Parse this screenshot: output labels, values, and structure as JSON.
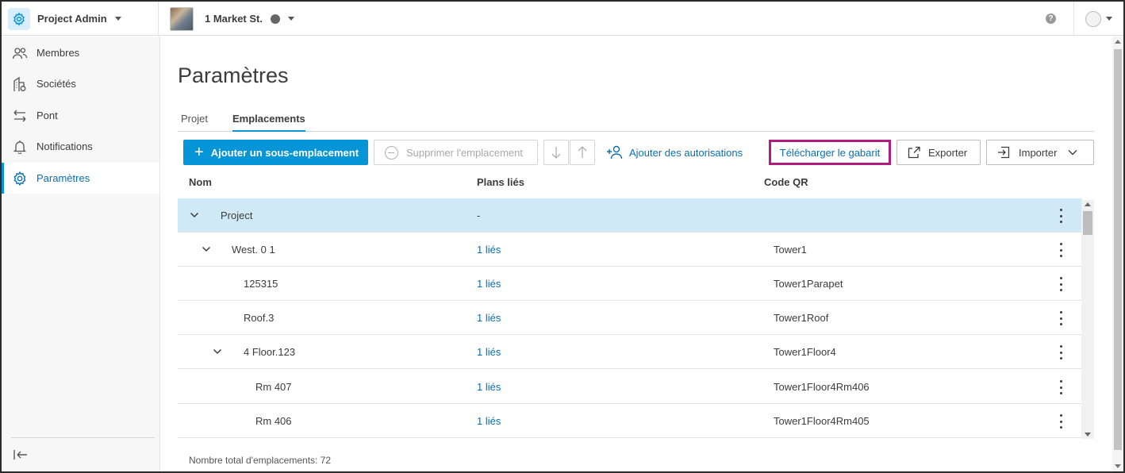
{
  "topbar": {
    "app_title": "Project Admin",
    "project_name": "1 Market St.",
    "help_glyph": "?"
  },
  "sidebar": {
    "items": [
      {
        "label": "Membres",
        "icon": "members-icon"
      },
      {
        "label": "Sociétés",
        "icon": "companies-icon"
      },
      {
        "label": "Pont",
        "icon": "bridge-icon"
      },
      {
        "label": "Notifications",
        "icon": "bell-icon"
      },
      {
        "label": "Paramètres",
        "icon": "gear-icon",
        "active": true
      }
    ]
  },
  "main": {
    "title": "Paramètres",
    "tabs": [
      {
        "label": "Projet"
      },
      {
        "label": "Emplacements",
        "active": true
      }
    ],
    "toolbar": {
      "add_sublocation": "Ajouter un sous-emplacement",
      "delete_location": "Supprimer l'emplacement",
      "add_permissions": "Ajouter des autorisations",
      "download_template": "Télécharger le gabarit",
      "export": "Exporter",
      "import": "Importer"
    },
    "columns": {
      "name": "Nom",
      "plans": "Plans liés",
      "qr": "Code QR"
    },
    "rows": [
      {
        "name": "Project",
        "plans": "-",
        "qr": "",
        "level": 0,
        "expanded": true,
        "selected": true
      },
      {
        "name": "West. 0 1",
        "plans": "1 liés",
        "qr": "Tower1",
        "level": 1,
        "expanded": true
      },
      {
        "name": "125315",
        "plans": "1 liés",
        "qr": "Tower1Parapet",
        "level": 2
      },
      {
        "name": "Roof.3",
        "plans": "1 liés",
        "qr": "Tower1Roof",
        "level": 2
      },
      {
        "name": "4 Floor.123",
        "plans": "1 liés",
        "qr": "Tower1Floor4",
        "level": 2,
        "expanded": true
      },
      {
        "name": "Rm 407",
        "plans": "1 liés",
        "qr": "Tower1Floor4Rm406",
        "level": 3
      },
      {
        "name": "Rm 406",
        "plans": "1 liés",
        "qr": "Tower1Floor4Rm405",
        "level": 3
      }
    ],
    "footer": "Nombre total d'emplacements: 72"
  },
  "colors": {
    "accent": "#0696d7",
    "link": "#0a6fb1",
    "selected_row": "#cfe9f6",
    "highlight_box": "#b01e7d"
  }
}
